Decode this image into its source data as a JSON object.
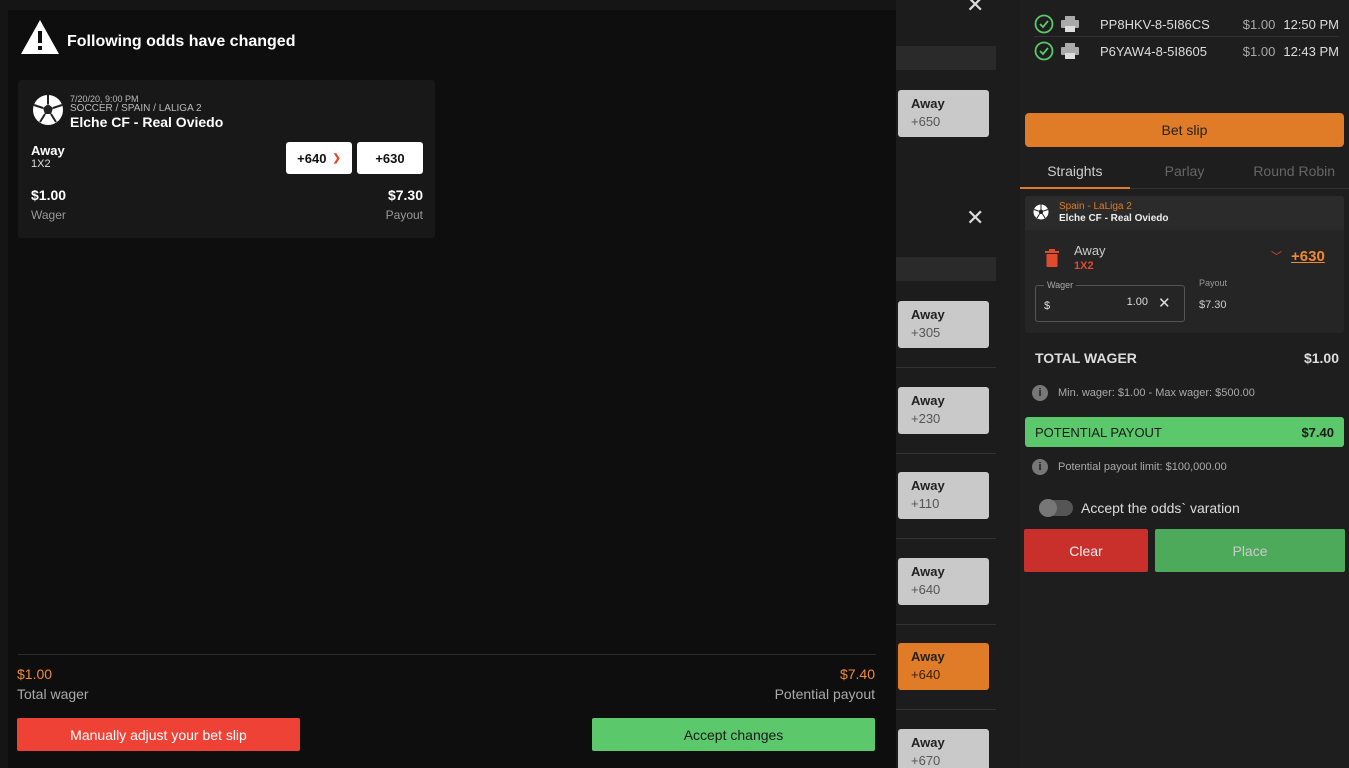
{
  "modal": {
    "title": "Following odds have changed",
    "card": {
      "date": "7/20/20, 9:00 PM",
      "league": "SOCCER / SPAIN / LALIGA 2",
      "event": "Elche CF - Real Oviedo",
      "selection": "Away",
      "market": "1X2",
      "old_odds": "+640",
      "new_odds": "+630",
      "wager_value": "$1.00",
      "wager_label": "Wager",
      "payout_value": "$7.30",
      "payout_label": "Payout"
    },
    "footer": {
      "total_wager_value": "$1.00",
      "total_wager_label": "Total wager",
      "potential_payout_value": "$7.40",
      "potential_payout_label": "Potential payout",
      "manual_button": "Manually adjust your bet slip",
      "accept_button": "Accept changes"
    }
  },
  "background_odds": [
    {
      "label": "Away",
      "value": "+650",
      "active": false
    },
    {
      "label": "Away",
      "value": "+305",
      "active": false
    },
    {
      "label": "Away",
      "value": "+230",
      "active": false
    },
    {
      "label": "Away",
      "value": "+110",
      "active": false
    },
    {
      "label": "Away",
      "value": "+640",
      "active": false
    },
    {
      "label": "Away",
      "value": "+640",
      "active": true
    },
    {
      "label": "Away",
      "value": "+670",
      "active": false
    }
  ],
  "tickets": [
    {
      "id": "PP8HKV-8-5I86CS",
      "amount": "$1.00",
      "time": "12:50 PM"
    },
    {
      "id": "P6YAW4-8-5I8605",
      "amount": "$1.00",
      "time": "12:43 PM"
    }
  ],
  "betslip": {
    "header_button": "Bet slip",
    "tabs": [
      "Straights",
      "Parlay",
      "Round Robin"
    ],
    "selection": {
      "league": "Spain - LaLiga 2",
      "event": "Elche CF - Real Oviedo",
      "name": "Away",
      "market": "1X2",
      "odds": "+630",
      "wager_label": "Wager",
      "currency": "$",
      "wager_value": "1.00",
      "payout_label": "Payout",
      "payout_value": "$7.30"
    },
    "total_wager_label": "TOTAL WAGER",
    "total_wager_value": "$1.00",
    "wager_limits": "Min. wager: $1.00 - Max wager: $500.00",
    "potential_payout_label": "POTENTIAL PAYOUT",
    "potential_payout_value": "$7.40",
    "payout_limit": "Potential payout limit: $100,000.00",
    "accept_variation_label": "Accept the odds` varation",
    "clear_button": "Clear",
    "place_button": "Place"
  },
  "colors": {
    "accent_orange": "#e07b27",
    "danger_red": "#ef4237",
    "success_green": "#5cc86c"
  }
}
